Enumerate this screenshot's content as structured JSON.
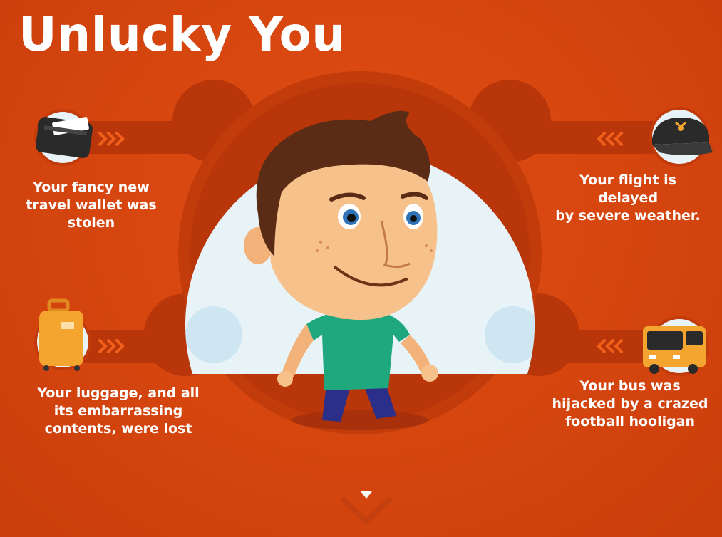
{
  "title": "Unlucky You",
  "items": [
    {
      "icon": "wallet-icon",
      "text": "Your fancy new\ntravel wallet was\nstolen"
    },
    {
      "icon": "luggage-icon",
      "text": "Your luggage, and all\nits embarrassing\ncontents, were lost"
    },
    {
      "icon": "pilot-cap-icon",
      "text": "Your flight is\ndelayed\nby severe weather."
    },
    {
      "icon": "bus-icon",
      "text": "Your bus was\nhijacked by a crazed\nfootball hooligan"
    }
  ],
  "colors": {
    "background": "#d9470f",
    "track": "#b8360a",
    "circle_light": "#e8f3f8",
    "accent_arrow": "#f0601a",
    "text": "#ffffff"
  }
}
